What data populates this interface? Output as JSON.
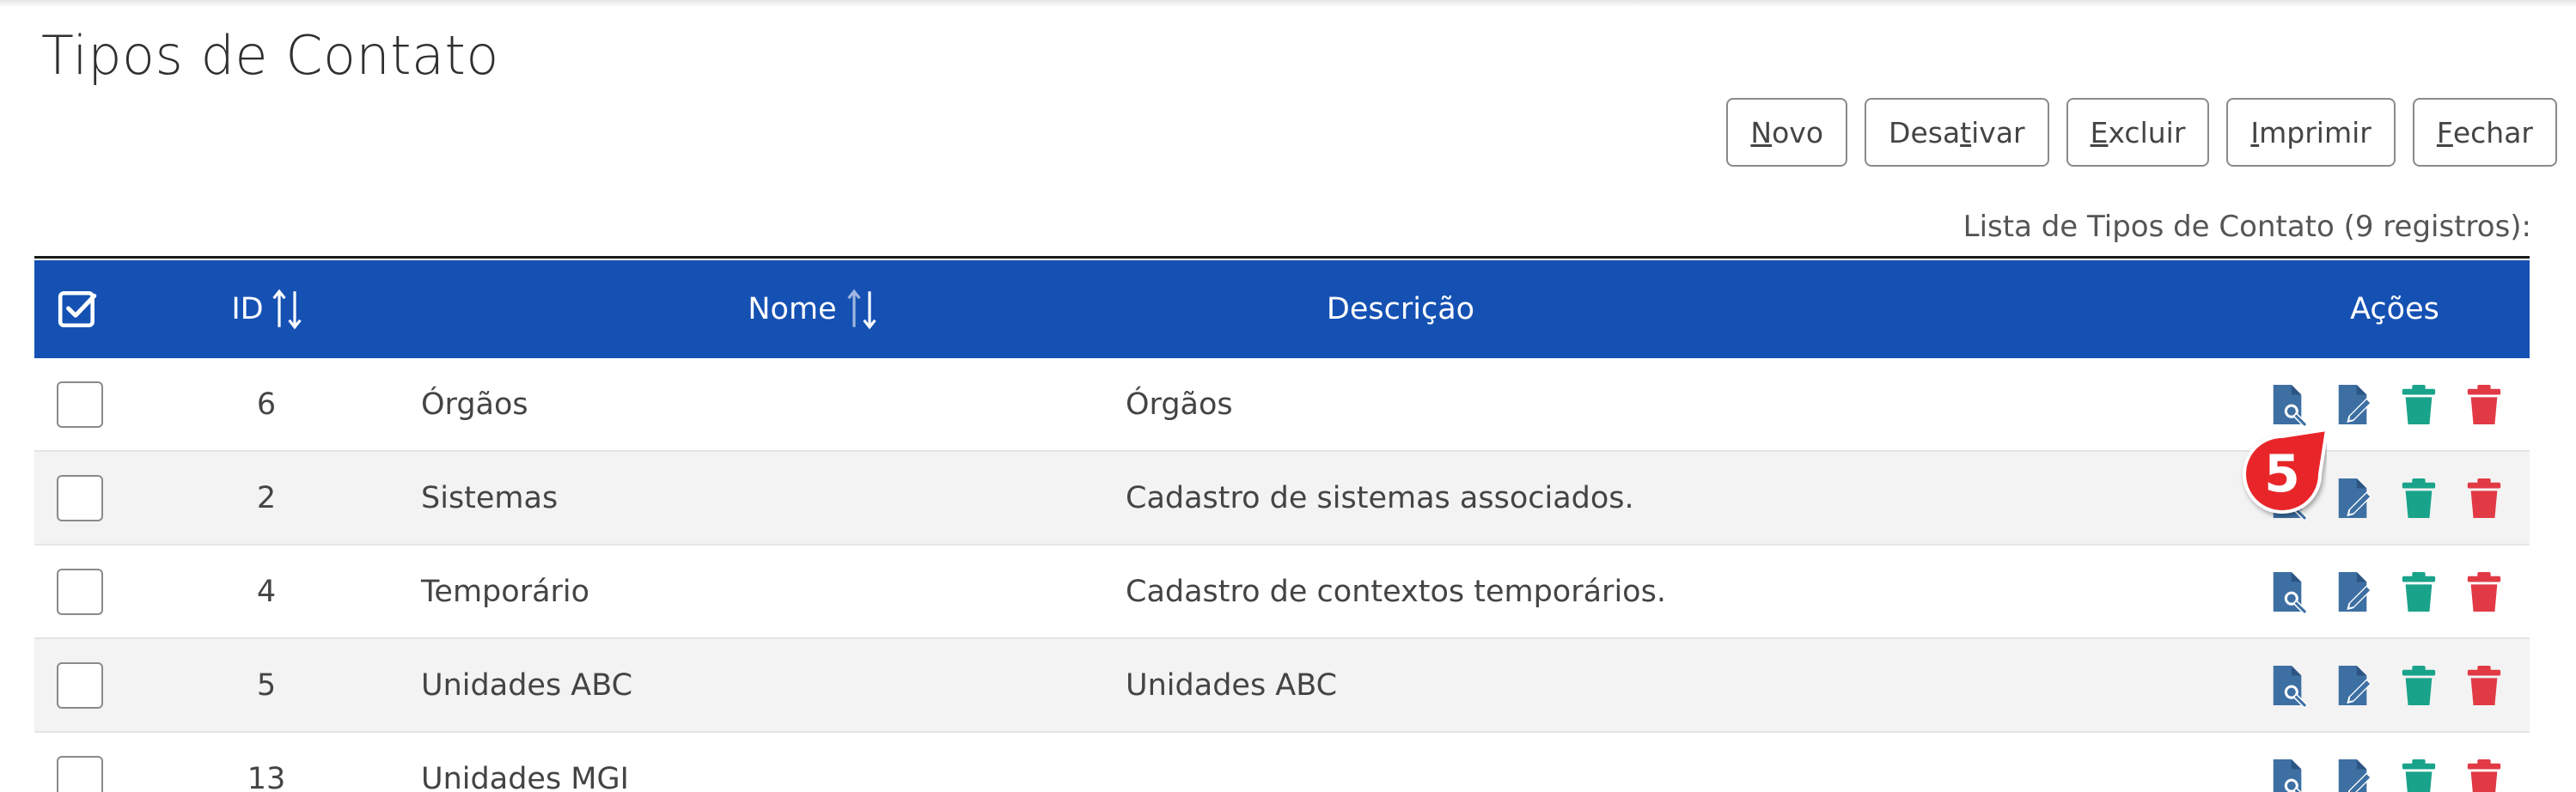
{
  "page": {
    "title": "Tipos de Contato"
  },
  "toolbar": {
    "novo": {
      "pre": "",
      "key": "N",
      "post": "ovo"
    },
    "desativar": {
      "pre": "Desa",
      "key": "t",
      "post": "ivar"
    },
    "excluir": {
      "pre": "",
      "key": "E",
      "post": "xcluir"
    },
    "imprimir": {
      "pre": "",
      "key": "I",
      "post": "mprimir"
    },
    "fechar": {
      "pre": "",
      "key": "F",
      "post": "echar"
    }
  },
  "list": {
    "caption": "Lista de Tipos de Contato (9 registros):"
  },
  "table": {
    "headers": {
      "id": "ID",
      "nome": "Nome",
      "descricao": "Descrição",
      "acoes": "Ações"
    },
    "rows": [
      {
        "id": "6",
        "nome": "Órgãos",
        "descricao": "Órgãos"
      },
      {
        "id": "2",
        "nome": "Sistemas",
        "descricao": "Cadastro de sistemas associados."
      },
      {
        "id": "4",
        "nome": "Temporário",
        "descricao": "Cadastro de contextos temporários."
      },
      {
        "id": "5",
        "nome": "Unidades ABC",
        "descricao": "Unidades ABC"
      },
      {
        "id": "13",
        "nome": "Unidades MGI",
        "descricao": ""
      }
    ]
  },
  "callout": {
    "number": "5"
  },
  "icons": {
    "view": "document-search-icon",
    "edit": "document-edit-icon",
    "deactivate": "trash-icon",
    "delete": "trash-icon"
  },
  "colors": {
    "header_bg": "#1551b3",
    "icon_blue": "#3d6fa3",
    "icon_green": "#19a38a",
    "icon_red": "#e23a45",
    "callout_red": "#e8262b"
  }
}
